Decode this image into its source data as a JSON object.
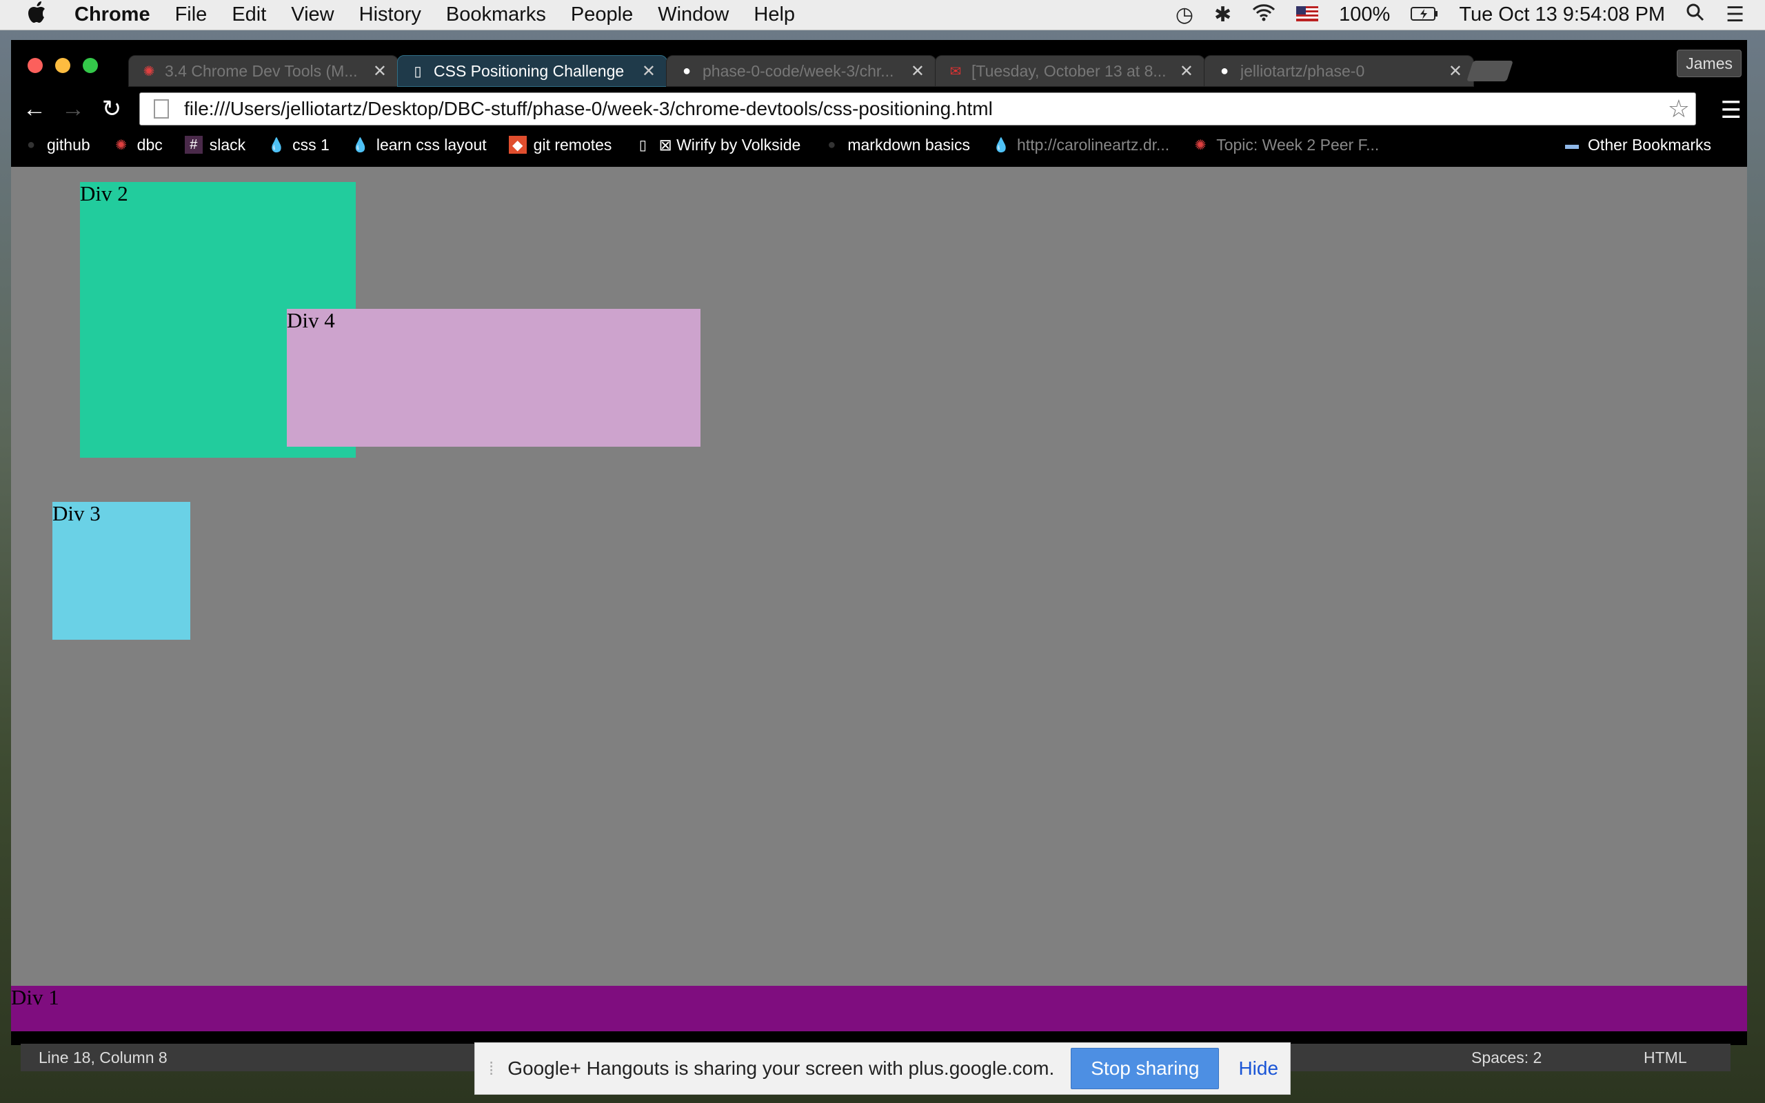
{
  "menubar": {
    "apple": "",
    "app": "Chrome",
    "items": [
      "File",
      "Edit",
      "View",
      "History",
      "Bookmarks",
      "People",
      "Window",
      "Help"
    ],
    "battery": "100%",
    "clock": "Tue Oct 13  9:54:08 PM"
  },
  "tabs": [
    {
      "title": "3.4 Chrome Dev Tools (M...",
      "icon": "dbc-icon",
      "active": false
    },
    {
      "title": "CSS Positioning Challenge",
      "icon": "document-icon",
      "active": true
    },
    {
      "title": "phase-0-code/week-3/chr...",
      "icon": "github-icon",
      "active": false
    },
    {
      "title": "[Tuesday, October 13 at 8...",
      "icon": "gmail-icon",
      "active": false
    },
    {
      "title": "jelliotartz/phase-0",
      "icon": "github-icon",
      "active": false
    }
  ],
  "profile": "James",
  "address": "file:///Users/jelliotartz/Desktop/DBC-stuff/phase-0/week-3/chrome-devtools/css-positioning.html",
  "bookmarks": [
    {
      "label": "github",
      "icon": "github-icon"
    },
    {
      "label": "dbc",
      "icon": "dbc-icon"
    },
    {
      "label": "slack",
      "icon": "slack-icon"
    },
    {
      "label": "css 1",
      "icon": "drop-icon"
    },
    {
      "label": "learn css layout",
      "icon": "drop-icon"
    },
    {
      "label": "git remotes",
      "icon": "git-icon"
    },
    {
      "label": "⊠ Wirify by Volkside",
      "icon": "document-icon"
    },
    {
      "label": "markdown basics",
      "icon": "github-icon"
    },
    {
      "label": "http://carolineartz.dr...",
      "icon": "drop-icon"
    },
    {
      "label": "Topic: Week 2 Peer F...",
      "icon": "dbc-icon"
    }
  ],
  "other_bookmarks": "Other Bookmarks",
  "page": {
    "div1": "Div 1",
    "div2": "Div 2",
    "div3": "Div 3",
    "div4": "Div 4"
  },
  "editor_status": {
    "position": "Line 18, Column 8",
    "spaces": "Spaces: 2",
    "syntax": "HTML"
  },
  "hangouts": {
    "message": "Google+ Hangouts is sharing your screen with plus.google.com.",
    "stop": "Stop sharing",
    "hide": "Hide"
  }
}
